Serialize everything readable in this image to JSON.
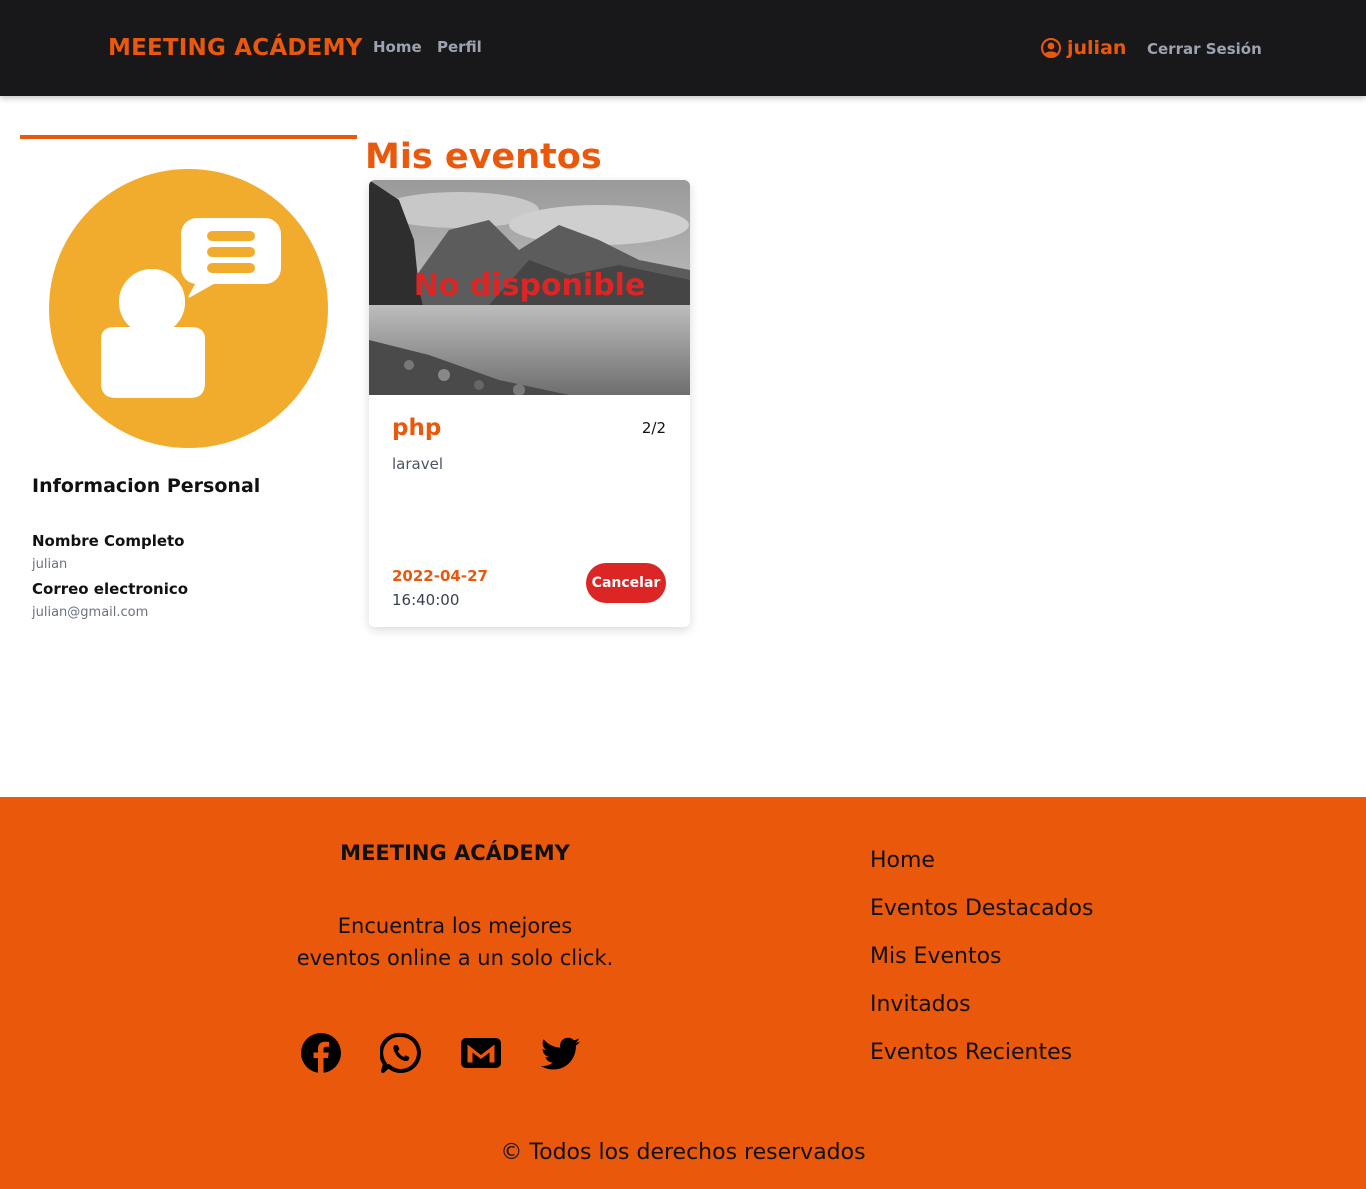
{
  "navbar": {
    "brand": "MEETING ACÁDEMY",
    "links": [
      "Home",
      "Perfil"
    ],
    "user_name": "julian",
    "logout_label": "Cerrar Sesión"
  },
  "profile": {
    "section_title": "Informacion Personal",
    "name_label": "Nombre Completo",
    "name_value": "julian",
    "email_label": "Correo electronico",
    "email_value": "julian@gmail.com"
  },
  "events": {
    "title": "Mis eventos",
    "cards": [
      {
        "overlay": "No disponible",
        "name": "php",
        "count": "2/2",
        "description": "laravel",
        "date": "2022-04-27",
        "time": "16:40:00",
        "action_label": "Cancelar"
      }
    ]
  },
  "footer": {
    "brand": "MEETING ACÁDEMY",
    "tagline_line1": "Encuentra los mejores",
    "tagline_line2": "eventos online a un solo click.",
    "social_icons": [
      "facebook-icon",
      "whatsapp-icon",
      "gmail-icon",
      "twitter-icon"
    ],
    "links": [
      "Home",
      "Eventos Destacados",
      "Mis Eventos",
      "Invitados",
      "Eventos Recientes"
    ],
    "copyright": "© Todos los derechos reservados"
  },
  "colors": {
    "accent": "#ea580c",
    "navbar_bg": "#18181b",
    "danger": "#dc2626",
    "avatar": "#f2ac2d"
  }
}
